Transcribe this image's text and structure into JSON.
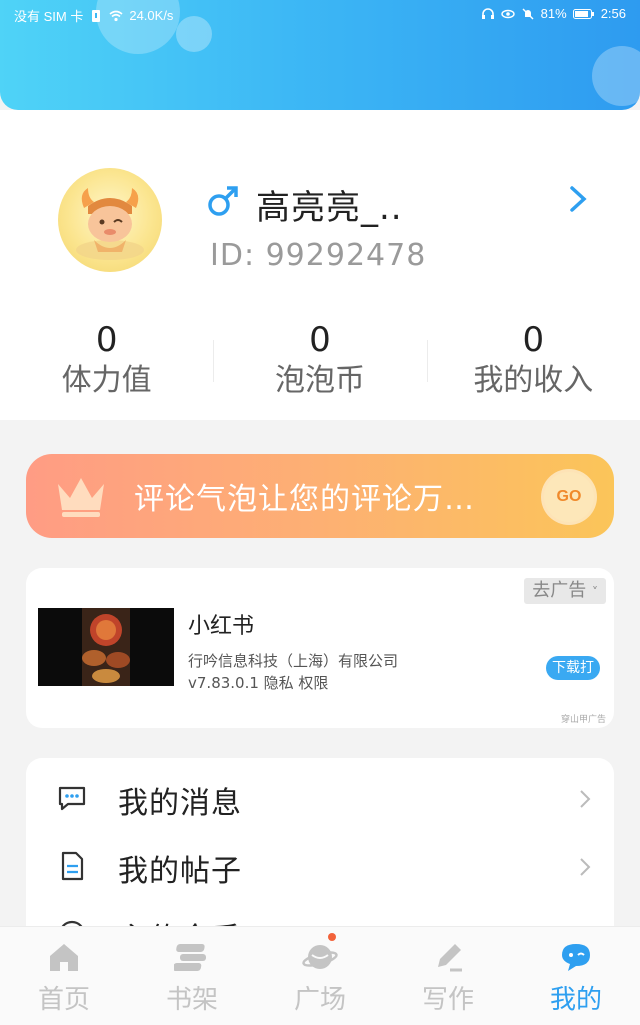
{
  "status_bar": {
    "carrier": "没有 SIM 卡",
    "speed": "24.0K/s",
    "battery": "81%",
    "time": "2:56"
  },
  "profile": {
    "username": "高亮亮_..",
    "user_id": "ID:  99292478",
    "gender_icon": "male-icon"
  },
  "stats": [
    {
      "value": "0",
      "label": "体力值"
    },
    {
      "value": "0",
      "label": "泡泡币"
    },
    {
      "value": "0",
      "label": "我的收入"
    }
  ],
  "promo": {
    "text": "评论气泡让您的评论万…",
    "go_label": "GO",
    "colors": {
      "start": "#ff9c84",
      "end": "#fbc559"
    }
  },
  "ad": {
    "close_label": "去广告",
    "app_name": "小红书",
    "company": "行吟信息科技（上海）有限公司",
    "version_line": "v7.83.0.1 隐私 权限",
    "download_label": "下载打",
    "source": "穿山甲广告"
  },
  "menu": {
    "items": [
      {
        "label": "我的消息",
        "icon": "message-icon"
      },
      {
        "label": "我的帖子",
        "icon": "document-icon"
      },
      {
        "label": "主传全手",
        "icon": "clock-icon"
      }
    ]
  },
  "bottom_nav": {
    "tabs": [
      {
        "label": "首页",
        "icon": "home-icon"
      },
      {
        "label": "书架",
        "icon": "bookshelf-icon"
      },
      {
        "label": "广场",
        "icon": "planet-icon"
      },
      {
        "label": "写作",
        "icon": "pen-icon"
      },
      {
        "label": "我的",
        "icon": "chat-bubble-icon"
      }
    ],
    "active_tab": "我的"
  },
  "colors": {
    "accent": "#2e9ff0",
    "header_start": "#4fd3f7",
    "header_end": "#2e9bf0"
  }
}
